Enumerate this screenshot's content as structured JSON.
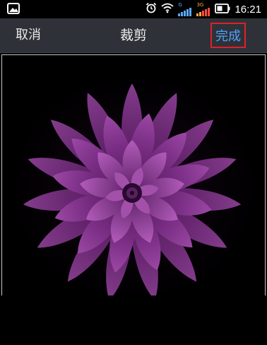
{
  "status_bar": {
    "time": "16:21",
    "network_small": "G",
    "network_3g": "3G",
    "icons": [
      "image-icon",
      "alarm-icon",
      "wifi-icon",
      "signal-icon",
      "signal-3g-icon",
      "battery-icon"
    ]
  },
  "toolbar": {
    "cancel_label": "取消",
    "title": "裁剪",
    "done_label": "完成"
  },
  "image": {
    "subject": "purple-flower-photo"
  },
  "colors": {
    "toolbar_bg": "#2e3238",
    "done_text": "#4da3ff",
    "highlight_border": "#e0202a",
    "flower": "#7a2e84"
  }
}
